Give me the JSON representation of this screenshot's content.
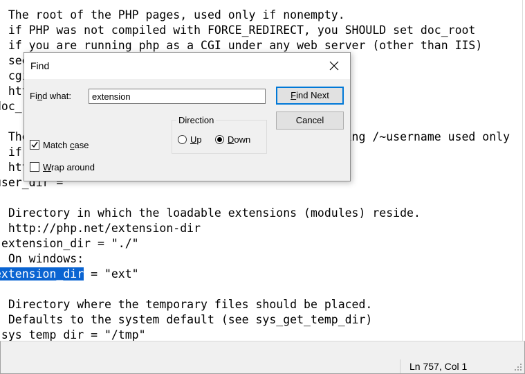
{
  "editor": {
    "lines": [
      "; The root of the PHP pages, used only if nonempty.",
      "; if PHP was not compiled with FORCE_REDIRECT, you SHOULD set doc_root",
      "; if you are running php as a CGI under any web server (other than IIS)",
      "; see doc/README.CGI. The alternate is to use the",
      "; cgi.force_redirect configuration below",
      "; http://php.net/doc-root",
      "doc_root =",
      "",
      "; The directory under which PHP opens the script using /~username used only",
      "; if nonempty.",
      "; http://php.net/user-dir",
      "user_dir =",
      "",
      "; Directory in which the loadable extensions (modules) reside.",
      "; http://php.net/extension-dir",
      ";extension_dir = \"./\"",
      "; On windows:"
    ],
    "selected_line": {
      "highlighted": "extension_dir",
      "rest": " = \"ext\""
    },
    "lines_after": [
      "",
      "; Directory where the temporary files should be placed.",
      "; Defaults to the system default (see sys_get_temp_dir)",
      ";sys_temp_dir = \"/tmp\""
    ]
  },
  "status": {
    "position": "Ln 757, Col 1"
  },
  "find_dialog": {
    "title": "Find",
    "find_what_prefix": "Fi",
    "find_what_accel": "n",
    "find_what_suffix": "d what:",
    "find_value": "extension",
    "find_next_prefix": "",
    "find_next_accel": "F",
    "find_next_suffix": "ind Next",
    "cancel_label": "Cancel",
    "direction_label": "Direction",
    "up_accel": "U",
    "up_suffix": "p",
    "down_accel": "D",
    "down_suffix": "own",
    "match_case_prefix": "Match ",
    "match_case_accel": "c",
    "match_case_suffix": "ase",
    "wrap_prefix": "",
    "wrap_accel": "W",
    "wrap_suffix": "rap around",
    "match_case_checked": true,
    "wrap_checked": false,
    "direction": "down"
  }
}
